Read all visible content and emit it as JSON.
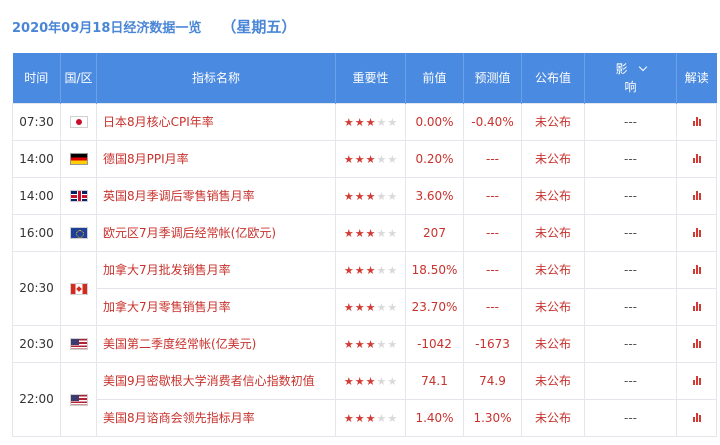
{
  "header": {
    "date_title": "2020年09月18日经济数据一览",
    "weekday": "（星期五）"
  },
  "columns": {
    "time": "时间",
    "country": "国/区",
    "indicator": "指标名称",
    "importance": "重要性",
    "previous": "前值",
    "forecast": "预测值",
    "published": "公布值",
    "impact_line1": "影",
    "impact_line2": "响",
    "analysis": "解读"
  },
  "colors": {
    "header_bg": "#4a8ae0",
    "accent_red": "#c8322d",
    "title_blue": "#4a86d6"
  },
  "rows": [
    {
      "time": "07:30",
      "flag": "japan-flag-icon",
      "name": "日本8月核心CPI年率",
      "stars": 3,
      "previous": "0.00%",
      "forecast": "-0.40%",
      "published": "未公布",
      "impact": "---"
    },
    {
      "time": "14:00",
      "flag": "germany-flag-icon",
      "name": "德国8月PPI月率",
      "stars": 3,
      "previous": "0.20%",
      "forecast": "---",
      "published": "未公布",
      "impact": "---"
    },
    {
      "time": "14:00",
      "flag": "uk-flag-icon",
      "name": "英国8月季调后零售销售月率",
      "stars": 3,
      "previous": "3.60%",
      "forecast": "---",
      "published": "未公布",
      "impact": "---"
    },
    {
      "time": "16:00",
      "flag": "eu-flag-icon",
      "name": "欧元区7月季调后经常帐(亿欧元)",
      "stars": 3,
      "previous": "207",
      "forecast": "---",
      "published": "未公布",
      "impact": "---"
    },
    {
      "time": "20:30",
      "flag": "canada-flag-icon",
      "name": "加拿大7月批发销售月率",
      "stars": 3,
      "previous": "18.50%",
      "forecast": "---",
      "published": "未公布",
      "impact": "---"
    },
    {
      "time": "",
      "flag": "",
      "name": "加拿大7月零售销售月率",
      "stars": 3,
      "previous": "23.70%",
      "forecast": "---",
      "published": "未公布",
      "impact": "---"
    },
    {
      "time": "20:30",
      "flag": "usa-flag-icon",
      "name": "美国第二季度经常帐(亿美元)",
      "stars": 3,
      "previous": "-1042",
      "forecast": "-1673",
      "published": "未公布",
      "impact": "---"
    },
    {
      "time": "22:00",
      "flag": "usa-flag-icon",
      "name": "美国9月密歇根大学消费者信心指数初值",
      "stars": 3,
      "previous": "74.1",
      "forecast": "74.9",
      "published": "未公布",
      "impact": "---"
    },
    {
      "time": "",
      "flag": "",
      "name": "美国8月谘商会领先指标月率",
      "stars": 3,
      "previous": "1.40%",
      "forecast": "1.30%",
      "published": "未公布",
      "impact": "---"
    }
  ]
}
